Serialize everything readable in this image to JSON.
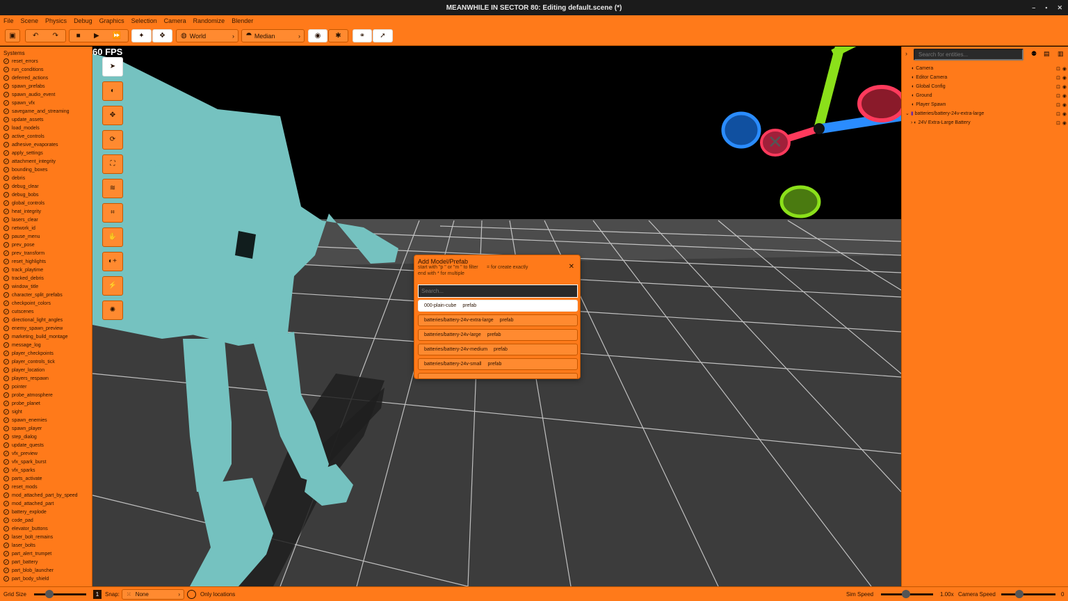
{
  "window": {
    "title": "MEANWHILE IN SECTOR 80: Editing default.scene (*)",
    "buttons": [
      "–",
      "▪",
      "✕"
    ]
  },
  "menu": [
    "File",
    "Scene",
    "Physics",
    "Debug",
    "Graphics",
    "Selection",
    "Camera",
    "Randomize",
    "Blender"
  ],
  "toolbar": {
    "space_value": "World",
    "pivot_value": "Median"
  },
  "systems": {
    "header": "Systems",
    "items": [
      "reset_errors",
      "run_conditions",
      "deferred_actions",
      "spawn_prefabs",
      "spawn_audio_event",
      "spawn_vfx",
      "savegame_and_streaming",
      "update_assets",
      "load_models",
      "active_controls",
      "adhesive_evaporates",
      "apply_settings",
      "attachment_integrity",
      "bounding_boxes",
      "debris",
      "debug_clear",
      "debug_bobs",
      "global_controls",
      "heat_integrity",
      "lasers_clear",
      "network_id",
      "pause_menu",
      "prev_pose",
      "prev_transform",
      "reset_highlights",
      "track_playtime",
      "tracked_debris",
      "window_title",
      "character_split_prefabs",
      "checkpoint_colors",
      "cutscenes",
      "directional_light_angles",
      "enemy_spawn_preview",
      "marketing_build_montage",
      "message_log",
      "player_checkpoints",
      "player_controls_tick",
      "player_location",
      "players_respawn",
      "pointer",
      "probe_atmosphere",
      "probe_planet",
      "sight",
      "spawn_enemies",
      "spawn_player",
      "step_dialog",
      "update_quests",
      "vfx_preview",
      "vfx_spark_burst",
      "vfx_sparks",
      "parts_activate",
      "reset_mods",
      "mod_attached_part_by_speed",
      "mod_attached_part",
      "battery_explode",
      "code_pad",
      "elevator_buttons",
      "laser_bolt_remains",
      "laser_bolts",
      "part_alert_trumpet",
      "part_battery",
      "part_blob_launcher",
      "part_body_shield"
    ]
  },
  "viewport": {
    "fps": "60 FPS"
  },
  "dialog": {
    "title": "Add Model/Prefab",
    "hint_1": "start with \"p \" or \"m \" to filter",
    "hint_2": "= for create exactly",
    "hint_3": "end with * for multiple",
    "search_placeholder": "Search...",
    "items": [
      {
        "name": "000-plain-cube",
        "kind": "prefab"
      },
      {
        "name": "batteries/battery-24v-extra-large",
        "kind": "prefab"
      },
      {
        "name": "batteries/battery-24v-large",
        "kind": "prefab"
      },
      {
        "name": "batteries/battery-24v-medium",
        "kind": "prefab"
      },
      {
        "name": "batteries/battery-24v-small",
        "kind": "prefab"
      }
    ]
  },
  "entities": {
    "search_placeholder": "Search for entities...",
    "items": [
      "Camera",
      "Editor Camera",
      "Global Config",
      "Ground",
      "Player Spawn",
      "batteries/battery-24v-extra-large",
      "24V Extra-Large Battery"
    ]
  },
  "status": {
    "grid_size_label": "Grid Size",
    "grid_value": "1",
    "snap_label": "Snap:",
    "snap_value": "None",
    "only_locations_label": "Only locations",
    "sim_speed_label": "Sim Speed",
    "sim_speed_value": "1.00x",
    "camera_speed_label": "Camera Speed",
    "camera_speed_value": "0"
  },
  "colors": {
    "panel": "#ff7a1a",
    "border": "#c45600",
    "character": "#75c2c0",
    "gizmo_x": "#ff3a5c",
    "gizmo_y": "#8be01a",
    "gizmo_z": "#2a8cff",
    "ground": "#3c3c3c"
  }
}
